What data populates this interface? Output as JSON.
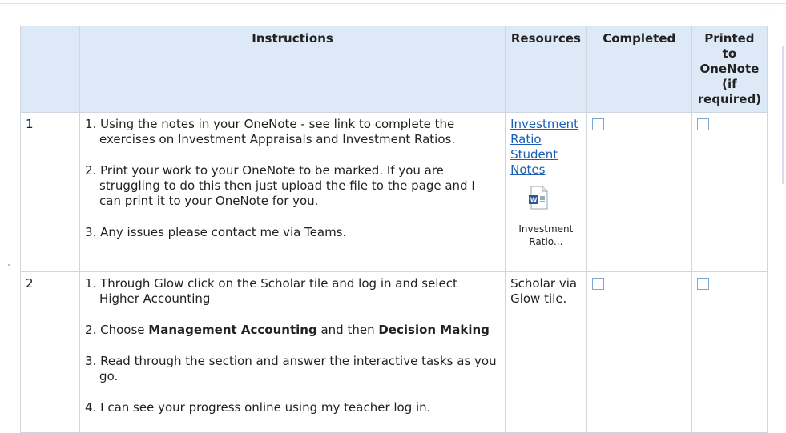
{
  "table": {
    "headers": {
      "num": "",
      "instructions": "Instructions",
      "resources": "Resources",
      "completed": "Completed",
      "printed": "Printed to OneNote (if required)"
    },
    "rows": [
      {
        "num": "1",
        "steps": [
          {
            "text": "1. Using the notes in your OneNote - see link to complete the exercises on Investment Appraisals and Investment Ratios."
          },
          {
            "text": "2. Print your work to your OneNote to be marked. If you are struggling to do this then just upload the file to the page and I can print it to your OneNote for you."
          },
          {
            "text": "3. Any issues please contact me via Teams."
          }
        ],
        "resource_link": "Investment Ratio Student Notes",
        "attachment_icon": "word-document-icon",
        "attachment_caption": "Investment Ratio...",
        "completed": false,
        "printed": false
      },
      {
        "num": "2",
        "steps": [
          {
            "text": "1. Through Glow click on the Scholar tile and log in and select Higher Accounting"
          },
          {
            "prefix": "2. Choose ",
            "bold1": "Management Accounting",
            "mid": " and then ",
            "bold2": "Decision Making"
          },
          {
            "text": "3. Read through the section and answer the interactive tasks as you go."
          },
          {
            "text": "4. I can see your progress online using my teacher log in."
          }
        ],
        "resource_text": "Scholar via Glow tile.",
        "completed": false,
        "printed": false
      }
    ]
  },
  "colors": {
    "header_bg": "#dde9f6",
    "grid": "#cfd6df",
    "link": "#1a5fb4",
    "checkbox_border": "#7ea7cf"
  }
}
